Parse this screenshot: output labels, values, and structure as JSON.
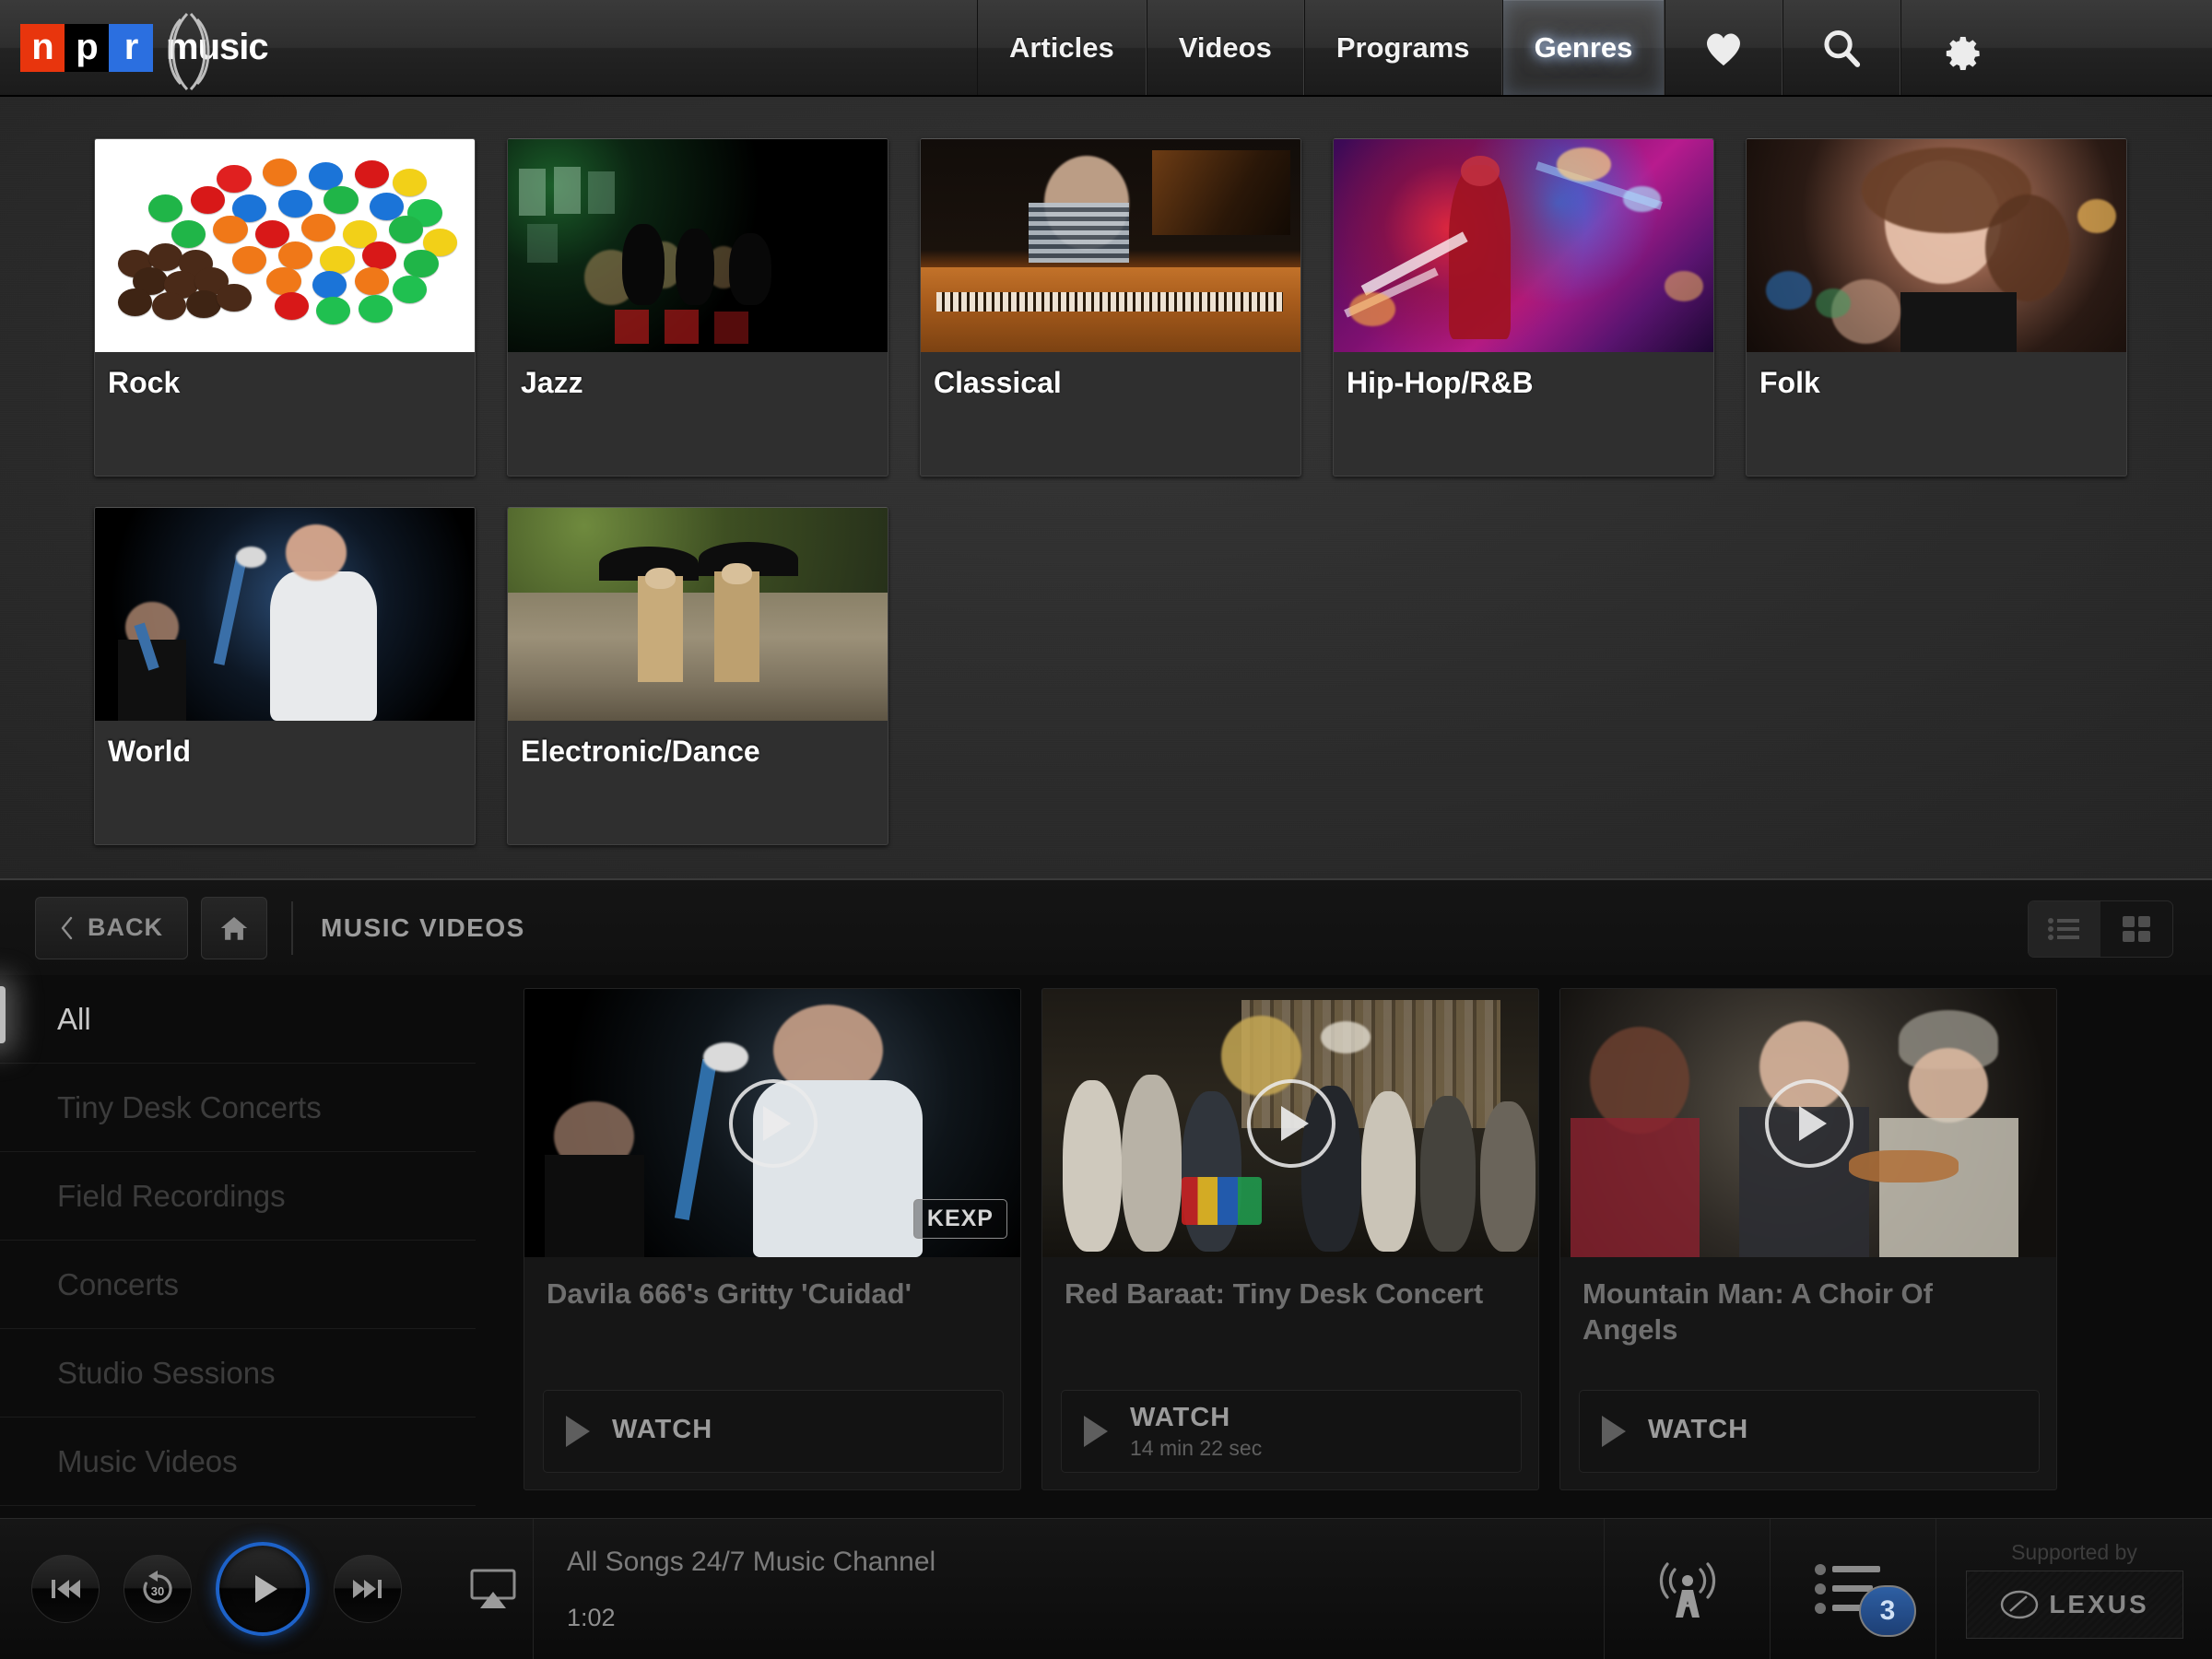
{
  "brand": {
    "letters": [
      "n",
      "p",
      "r"
    ],
    "word": "music",
    "colors": {
      "n_bg": "#e8350d",
      "p_bg": "#000000",
      "r_bg": "#2b6fe0"
    }
  },
  "topnav": {
    "tabs": [
      {
        "label": "Articles",
        "active": false
      },
      {
        "label": "Videos",
        "active": false
      },
      {
        "label": "Programs",
        "active": false
      },
      {
        "label": "Genres",
        "active": true
      }
    ],
    "icons": [
      {
        "name": "heart-icon"
      },
      {
        "name": "search-icon"
      },
      {
        "name": "gear-icon"
      }
    ]
  },
  "genres": [
    {
      "label": "Rock",
      "art": "art-rock",
      "bleed": false
    },
    {
      "label": "Jazz",
      "art": "art-jazz",
      "bleed": false
    },
    {
      "label": "Classical",
      "art": "art-classical",
      "bleed": true
    },
    {
      "label": "Hip-Hop/R&B",
      "art": "art-hiphop",
      "bleed": true
    },
    {
      "label": "Folk",
      "art": "art-folk",
      "bleed": true
    },
    {
      "label": "World",
      "art": "art-world",
      "bleed": false
    },
    {
      "label": "Electronic/Dance",
      "art": "art-electronic",
      "bleed": false
    }
  ],
  "subnav": {
    "back_label": "BACK",
    "home_icon": "home-icon",
    "title": "MUSIC VIDEOS",
    "view_list_icon": "list-view-icon",
    "view_grid_icon": "grid-view-icon",
    "active_view": "list"
  },
  "categories": [
    {
      "label": "All",
      "active": true
    },
    {
      "label": "Tiny Desk Concerts",
      "active": false
    },
    {
      "label": "Field Recordings",
      "active": false
    },
    {
      "label": "Concerts",
      "active": false
    },
    {
      "label": "Studio Sessions",
      "active": false
    },
    {
      "label": "Music Videos",
      "active": false
    }
  ],
  "videos": [
    {
      "title": "Davila 666's Gritty 'Cuidad'",
      "badge": "KEXP",
      "watch_label": "WATCH",
      "duration": "",
      "thumb": "thumb-davila"
    },
    {
      "title": "Red Baraat: Tiny Desk Concert",
      "badge": "",
      "watch_label": "WATCH",
      "duration": "14 min 22 sec",
      "thumb": "thumb-redbaraat"
    },
    {
      "title": "Mountain Man: A Choir Of Angels",
      "badge": "",
      "watch_label": "WATCH",
      "duration": "",
      "thumb": "thumb-mountainman"
    }
  ],
  "player": {
    "controls": [
      {
        "name": "previous-track-button"
      },
      {
        "name": "rewind-30-button",
        "label": "30"
      },
      {
        "name": "play-button"
      },
      {
        "name": "next-track-button"
      },
      {
        "name": "airplay-button"
      }
    ],
    "now_playing": "All Songs 24/7 Music Channel",
    "elapsed": "1:02",
    "radio_icon": "radio-tower-icon",
    "queue_icon": "playlist-icon",
    "queue_count": "3",
    "sponsor_label": "Supported by",
    "sponsor_name": "LEXUS",
    "accent_color": "#1d62c9"
  }
}
